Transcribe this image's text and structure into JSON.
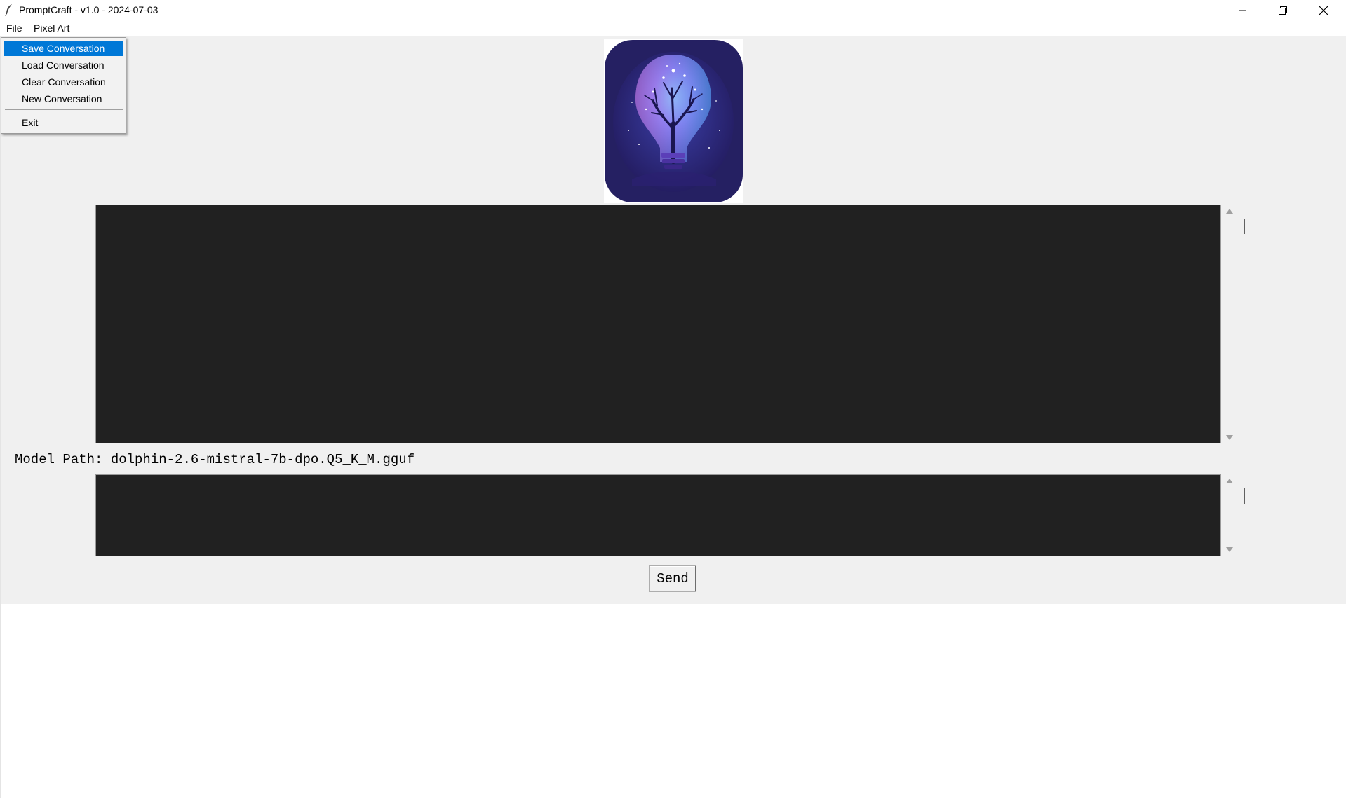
{
  "window": {
    "title": "PromptCraft - v1.0 - 2024-07-03",
    "icon": "feather-icon",
    "controls": [
      "minimize-icon",
      "restore-icon",
      "close-icon"
    ]
  },
  "menubar": {
    "items": [
      {
        "label": "File"
      },
      {
        "label": "Pixel Art"
      }
    ]
  },
  "file_menu": {
    "items": [
      {
        "label": "Save Conversation",
        "selected": true
      },
      {
        "label": "Load Conversation",
        "selected": false
      },
      {
        "label": "Clear Conversation",
        "selected": false
      },
      {
        "label": "New Conversation",
        "selected": false
      },
      {
        "label": "Exit",
        "selected": false
      }
    ],
    "highlight_color": "#0078d7"
  },
  "main": {
    "logo": "lightbulb-tree-logo",
    "chat_output_bg": "#212121",
    "model_path_label": "Model Path: dolphin-2.6-mistral-7b-dpo.Q5_K_M.gguf",
    "input_bg": "#212121",
    "send_label": "Send"
  }
}
